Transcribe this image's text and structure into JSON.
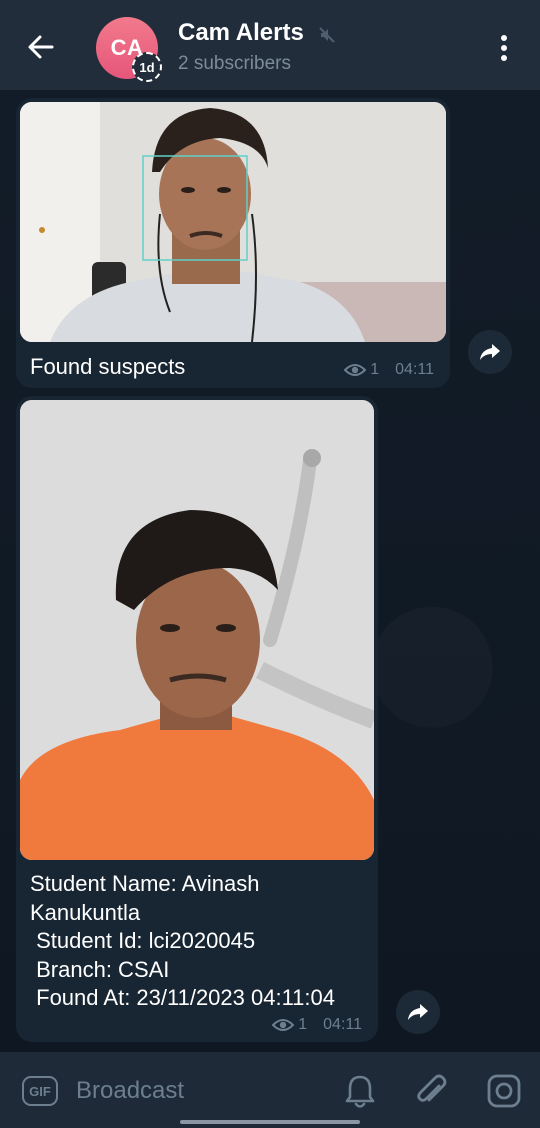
{
  "header": {
    "avatar_initials": "CA",
    "avatar_badge": "1d",
    "title": "Cam Alerts",
    "subtitle": "2 subscribers"
  },
  "messages": [
    {
      "caption": "Found suspects",
      "views": "1",
      "time": "04:11",
      "photo_description_icon": "face-detection-photo"
    },
    {
      "caption": "Student Name: Avinash\nKanukuntla\n Student Id: lci2020045\n Branch: CSAI\n Found At: 23/11/2023 04:11:04",
      "views": "1",
      "time": "04:11",
      "photo_description_icon": "student-photo"
    }
  ],
  "input": {
    "gif_label": "GIF",
    "placeholder": "Broadcast"
  },
  "colors": {
    "header_bg": "#212d3b",
    "bubble_bg": "#182533",
    "avatar": "#e5567b",
    "meta_text": "#6d7f8f"
  }
}
